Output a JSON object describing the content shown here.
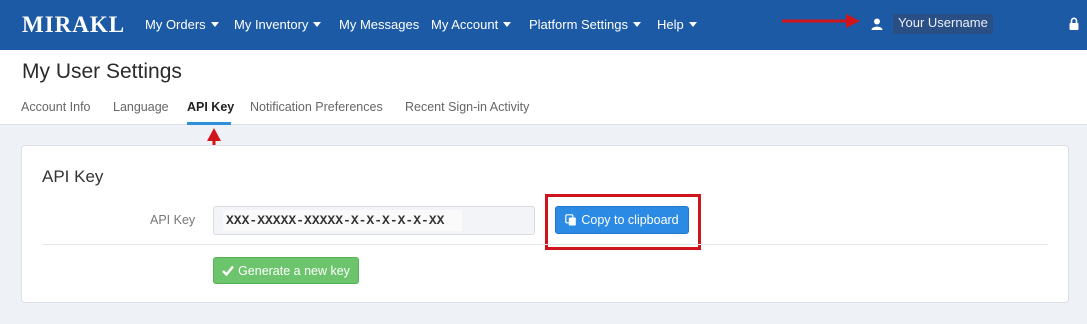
{
  "app": {
    "logo": "MIRAKL"
  },
  "nav": {
    "items": [
      {
        "label": "My Orders",
        "dropdown": true
      },
      {
        "label": "My Inventory",
        "dropdown": true
      },
      {
        "label": "My Messages",
        "dropdown": false
      },
      {
        "label": "My Account",
        "dropdown": true
      },
      {
        "label": "Platform Settings",
        "dropdown": true
      },
      {
        "label": "Help",
        "dropdown": true
      }
    ],
    "username": "Your Username",
    "icons": [
      "user-icon",
      "lock-icon"
    ]
  },
  "page": {
    "title": "My User Settings",
    "tabs": [
      {
        "label": "Account Info",
        "active": false
      },
      {
        "label": "Language",
        "active": false
      },
      {
        "label": "API Key",
        "active": true
      },
      {
        "label": "Notification Preferences",
        "active": false
      },
      {
        "label": "Recent Sign-in Activity",
        "active": false
      }
    ]
  },
  "panel": {
    "title": "API Key",
    "field_label": "API Key",
    "key_value": "XXX-XXXXX-XXXXX-X-X-X-X-X-XX",
    "copy_label": "Copy to clipboard",
    "generate_label": "Generate a new key"
  },
  "colors": {
    "navbar": "#1c5aa6",
    "copy_button": "#2b8be4",
    "generate_button": "#6cc56c",
    "annotation_red": "#d0141c",
    "active_tab_underline": "#2f8fd8"
  }
}
